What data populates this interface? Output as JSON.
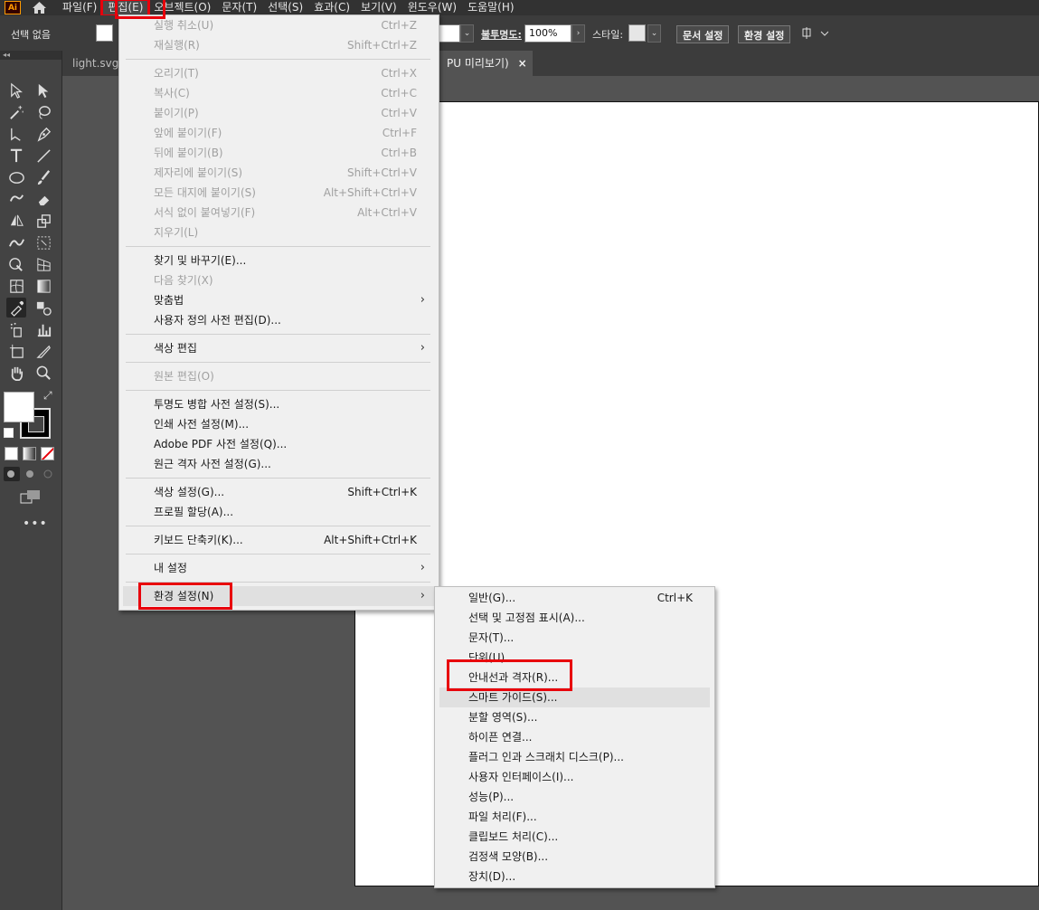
{
  "app": {
    "logo": "Ai"
  },
  "menubar": [
    "파일(F)",
    "편집(E)",
    "오브젝트(O)",
    "문자(T)",
    "선택(S)",
    "효과(C)",
    "보기(V)",
    "윈도우(W)",
    "도움말(H)"
  ],
  "controlbar": {
    "selection_text": "선택 없음",
    "opacity_label": "불투명도:",
    "opacity_value": "100%",
    "style_label": "스타일:",
    "doc_setup_button": "문서 설정",
    "prefs_button": "환경 설정"
  },
  "tabs": [
    "light.svg",
    "PU 미리보기)"
  ],
  "tab_close": "×",
  "edit_menu": [
    {
      "label": "실행 취소(U)",
      "shortcut": "Ctrl+Z",
      "disabled": true
    },
    {
      "label": "재실행(R)",
      "shortcut": "Shift+Ctrl+Z",
      "disabled": true
    },
    {
      "sep": true
    },
    {
      "label": "오리기(T)",
      "shortcut": "Ctrl+X",
      "disabled": true
    },
    {
      "label": "복사(C)",
      "shortcut": "Ctrl+C",
      "disabled": true
    },
    {
      "label": "붙이기(P)",
      "shortcut": "Ctrl+V",
      "disabled": true
    },
    {
      "label": "앞에 붙이기(F)",
      "shortcut": "Ctrl+F",
      "disabled": true
    },
    {
      "label": "뒤에 붙이기(B)",
      "shortcut": "Ctrl+B",
      "disabled": true
    },
    {
      "label": "제자리에 붙이기(S)",
      "shortcut": "Shift+Ctrl+V",
      "disabled": true
    },
    {
      "label": "모든 대지에 붙이기(S)",
      "shortcut": "Alt+Shift+Ctrl+V",
      "disabled": true
    },
    {
      "label": "서식 없이 붙여넣기(F)",
      "shortcut": "Alt+Ctrl+V",
      "disabled": true
    },
    {
      "label": "지우기(L)",
      "shortcut": "",
      "disabled": true
    },
    {
      "sep": true
    },
    {
      "label": "찾기 및 바꾸기(E)...",
      "shortcut": "",
      "disabled": false
    },
    {
      "label": "다음 찾기(X)",
      "shortcut": "",
      "disabled": true
    },
    {
      "label": "맞춤법",
      "shortcut": "",
      "disabled": false,
      "submenu": true
    },
    {
      "label": "사용자 정의 사전 편집(D)...",
      "shortcut": "",
      "disabled": false
    },
    {
      "sep": true
    },
    {
      "label": "색상 편집",
      "shortcut": "",
      "disabled": false,
      "submenu": true
    },
    {
      "sep": true
    },
    {
      "label": "원본 편집(O)",
      "shortcut": "",
      "disabled": true
    },
    {
      "sep": true
    },
    {
      "label": "투명도 병합 사전 설정(S)...",
      "shortcut": "",
      "disabled": false
    },
    {
      "label": "인쇄 사전 설정(M)...",
      "shortcut": "",
      "disabled": false
    },
    {
      "label": "Adobe PDF 사전 설정(Q)...",
      "shortcut": "",
      "disabled": false
    },
    {
      "label": "원근 격자 사전 설정(G)...",
      "shortcut": "",
      "disabled": false
    },
    {
      "sep": true
    },
    {
      "label": "색상 설정(G)...",
      "shortcut": "Shift+Ctrl+K",
      "disabled": false
    },
    {
      "label": "프로필 할당(A)...",
      "shortcut": "",
      "disabled": false
    },
    {
      "sep": true
    },
    {
      "label": "키보드 단축키(K)...",
      "shortcut": "Alt+Shift+Ctrl+K",
      "disabled": false
    },
    {
      "sep": true
    },
    {
      "label": "내 설정",
      "shortcut": "",
      "disabled": false,
      "submenu": true
    },
    {
      "sep": true
    },
    {
      "label": "환경 설정(N)",
      "shortcut": "",
      "disabled": false,
      "submenu": true,
      "highlighted": true
    }
  ],
  "prefs_submenu": [
    {
      "label": "일반(G)...",
      "shortcut": "Ctrl+K"
    },
    {
      "label": "선택 및 고정점 표시(A)...",
      "shortcut": ""
    },
    {
      "label": "문자(T)...",
      "shortcut": ""
    },
    {
      "label": "단위(U)...",
      "shortcut": ""
    },
    {
      "label": "안내선과 격자(R)...",
      "shortcut": ""
    },
    {
      "label": "스마트 가이드(S)...",
      "shortcut": "",
      "highlighted": true
    },
    {
      "label": "분할 영역(S)...",
      "shortcut": ""
    },
    {
      "label": "하이픈 연결...",
      "shortcut": ""
    },
    {
      "label": "플러그 인과 스크래치 디스크(P)...",
      "shortcut": ""
    },
    {
      "label": "사용자 인터페이스(I)...",
      "shortcut": ""
    },
    {
      "label": "성능(P)...",
      "shortcut": ""
    },
    {
      "label": "파일 처리(F)...",
      "shortcut": ""
    },
    {
      "label": "클립보드 처리(C)...",
      "shortcut": ""
    },
    {
      "label": "검정색 모양(B)...",
      "shortcut": ""
    },
    {
      "label": "장치(D)...",
      "shortcut": ""
    }
  ],
  "colors": {
    "annotation_red": "#e8000b",
    "menu_bg": "#f0f0f0",
    "chrome_dark": "#323232"
  }
}
